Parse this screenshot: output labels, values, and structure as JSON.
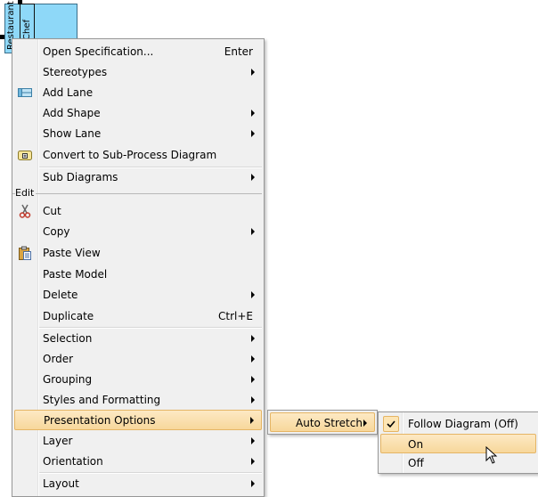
{
  "diagram": {
    "pool_label": "Restaurant",
    "lane_label": "Chef"
  },
  "menu": {
    "items": [
      {
        "label": "Open Specification...",
        "accel": "Enter"
      },
      {
        "label": "Stereotypes"
      },
      {
        "label": "Add Lane"
      },
      {
        "label": "Add Shape"
      },
      {
        "label": "Show Lane"
      },
      {
        "label": "Convert to Sub-Process Diagram"
      },
      {
        "label": "Sub Diagrams"
      },
      {
        "label": "Cut"
      },
      {
        "label": "Copy"
      },
      {
        "label": "Paste View"
      },
      {
        "label": "Paste Model"
      },
      {
        "label": "Delete"
      },
      {
        "label": "Duplicate",
        "accel": "Ctrl+E"
      },
      {
        "label": "Selection"
      },
      {
        "label": "Order"
      },
      {
        "label": "Grouping"
      },
      {
        "label": "Styles and Formatting"
      },
      {
        "label": "Presentation Options"
      },
      {
        "label": "Layer"
      },
      {
        "label": "Orientation"
      },
      {
        "label": "Layout"
      }
    ],
    "group_edit": "Edit"
  },
  "submenu": {
    "auto_stretch": "Auto Stretch"
  },
  "submenu2": {
    "items": [
      {
        "label": "Follow Diagram (Off)",
        "checked": true
      },
      {
        "label": "On",
        "highlighted": true
      },
      {
        "label": "Off"
      }
    ]
  },
  "icons": {
    "add_lane": "lane-icon",
    "convert": "subprocess-icon",
    "cut": "scissors-icon",
    "paste": "clipboard-icon",
    "check": "checkmark-icon"
  },
  "colors": {
    "highlight_top": "#fde9c4",
    "highlight_bottom": "#f7d79b",
    "pool_fill": "#8ed8f8"
  }
}
